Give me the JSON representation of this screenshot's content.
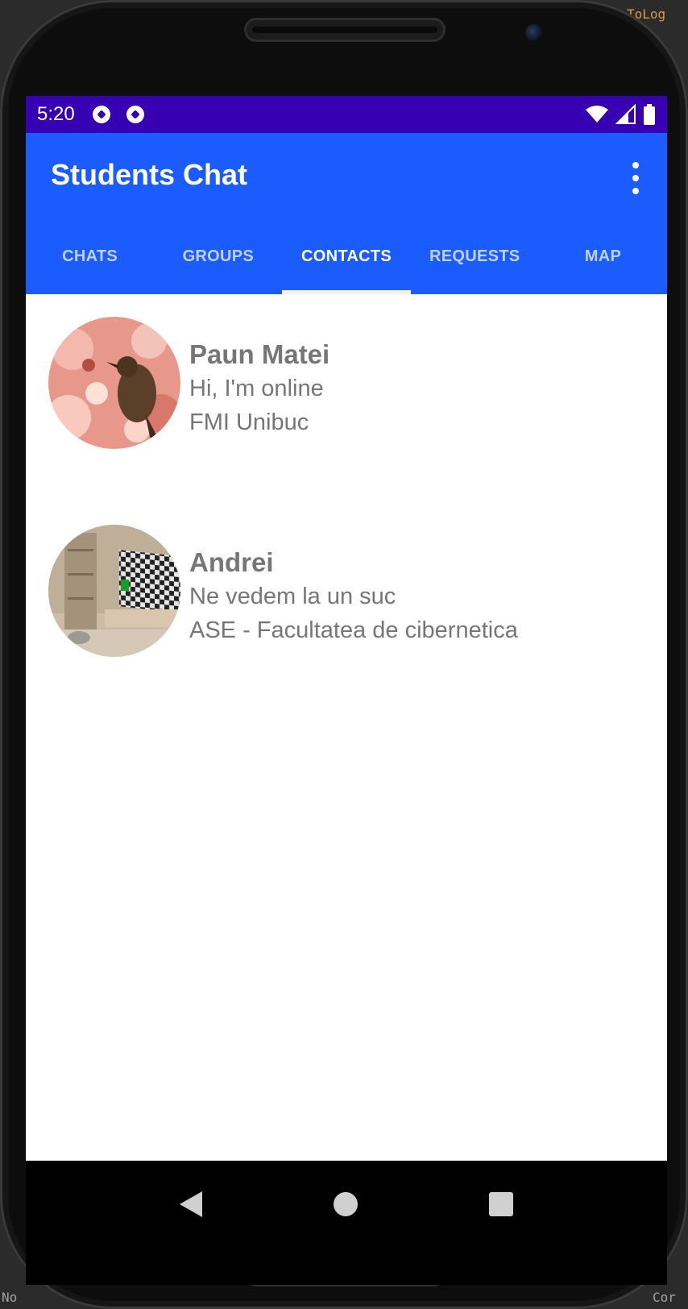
{
  "ide": {
    "top_left": ".",
    "top_right": "ToLog",
    "bottom_left": "No",
    "bottom_right": "Cor"
  },
  "status_bar": {
    "time": "5:20"
  },
  "app_bar": {
    "title": "Students Chat"
  },
  "tabs": [
    {
      "label": "CHATS",
      "active": false
    },
    {
      "label": "GROUPS",
      "active": false
    },
    {
      "label": "CONTACTS",
      "active": true
    },
    {
      "label": "REQUESTS",
      "active": false
    },
    {
      "label": "MAP",
      "active": false
    }
  ],
  "contacts": [
    {
      "name": "Paun Matei",
      "status": "Hi, I'm online",
      "school": "FMI Unibuc"
    },
    {
      "name": "Andrei",
      "status": "Ne vedem la un suc",
      "school": "ASE - Facultatea de cibernetica"
    }
  ],
  "colors": {
    "status_bar": "#3700b3",
    "app_bar": "#1b5cff",
    "text_secondary": "#767676"
  }
}
